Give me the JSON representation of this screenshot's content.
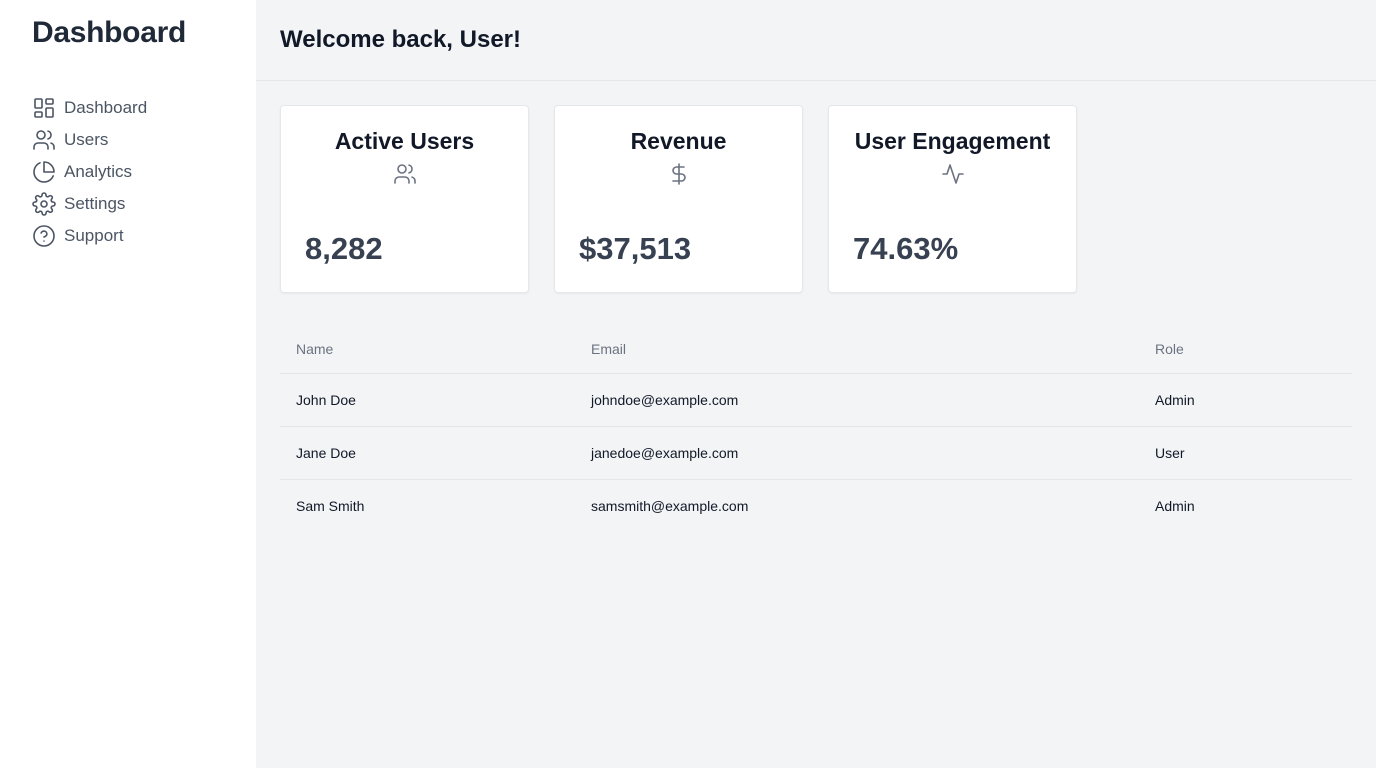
{
  "sidebar": {
    "title": "Dashboard",
    "items": [
      {
        "label": "Dashboard",
        "icon": "dashboard-icon"
      },
      {
        "label": "Users",
        "icon": "users-icon"
      },
      {
        "label": "Analytics",
        "icon": "pie-chart-icon"
      },
      {
        "label": "Settings",
        "icon": "gear-icon"
      },
      {
        "label": "Support",
        "icon": "help-circle-icon"
      }
    ]
  },
  "header": {
    "title": "Welcome back, User!"
  },
  "cards": [
    {
      "title": "Active Users",
      "icon": "users-icon",
      "value": "8,282"
    },
    {
      "title": "Revenue",
      "icon": "dollar-icon",
      "value": "$37,513"
    },
    {
      "title": "User Engagement",
      "icon": "activity-icon",
      "value": "74.63%"
    }
  ],
  "table": {
    "columns": [
      "Name",
      "Email",
      "Role"
    ],
    "rows": [
      {
        "name": "John Doe",
        "email": "johndoe@example.com",
        "role": "Admin"
      },
      {
        "name": "Jane Doe",
        "email": "janedoe@example.com",
        "role": "User"
      },
      {
        "name": "Sam Smith",
        "email": "samsmith@example.com",
        "role": "Admin"
      }
    ]
  },
  "colors": {
    "sidebar_bg": "#ffffff",
    "main_bg": "#f3f4f6",
    "text_primary": "#111827",
    "text_muted": "#6b7280",
    "value_text": "#374151"
  }
}
